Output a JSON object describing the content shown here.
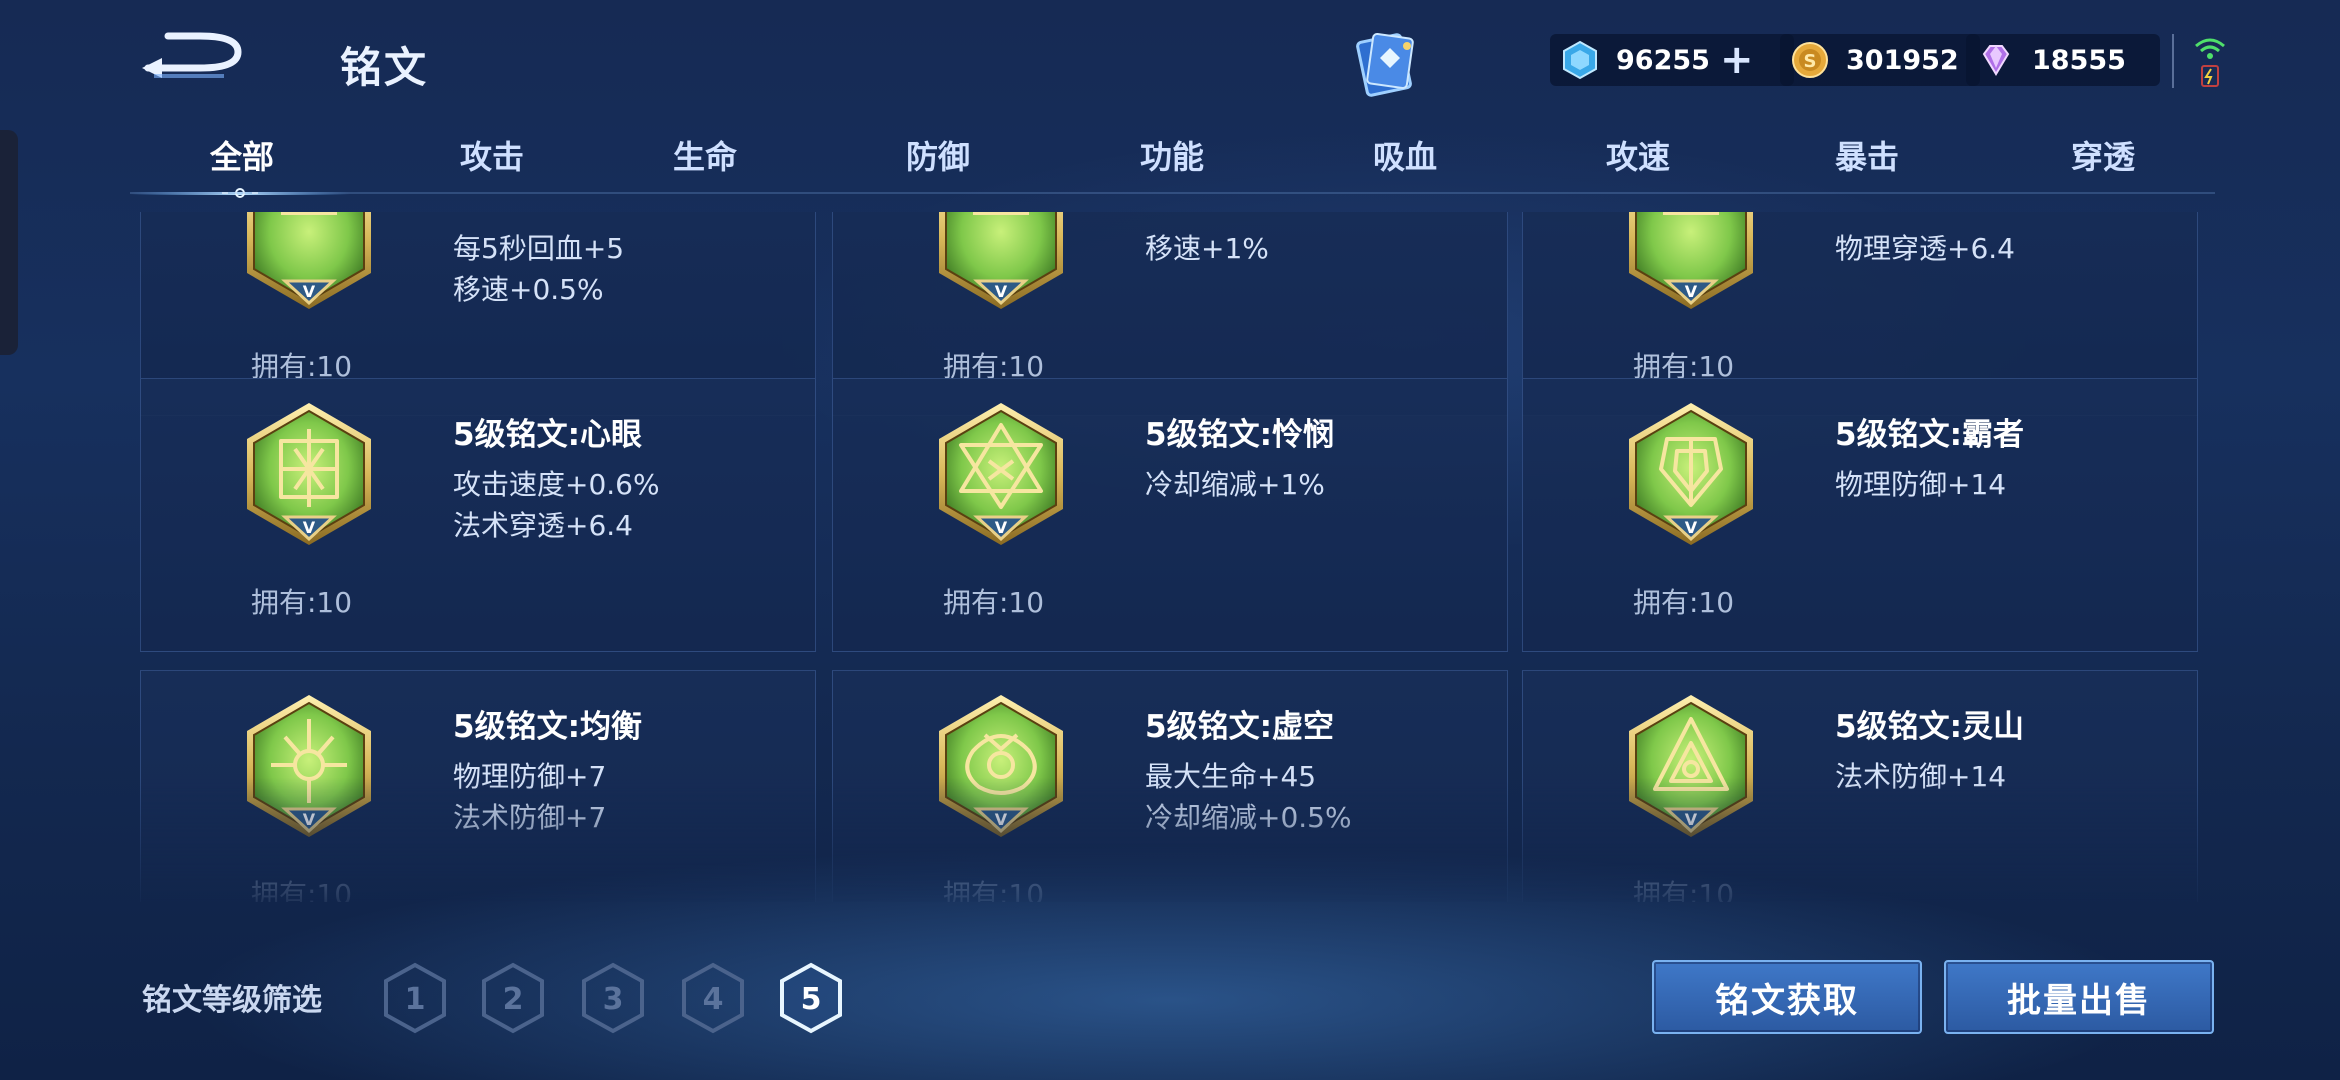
{
  "header": {
    "title": "铭文",
    "currency": {
      "diamond": "96255",
      "diamond_plus": "+",
      "gold": "301952",
      "gem": "18555"
    }
  },
  "tabs": [
    {
      "label": "全部",
      "active": true
    },
    {
      "label": "攻击"
    },
    {
      "label": "生命"
    },
    {
      "label": "防御"
    },
    {
      "label": "功能"
    },
    {
      "label": "吸血"
    },
    {
      "label": "攻速"
    },
    {
      "label": "暴击"
    },
    {
      "label": "穿透"
    }
  ],
  "inscriptions": [
    {
      "name": "",
      "attr1": "每5秒回血+5",
      "attr2": "移速+0.5%",
      "owned": "拥有:10",
      "icon": "inscription-partial-icon"
    },
    {
      "name": "",
      "attr1": "移速+1%",
      "attr2": "",
      "owned": "拥有:10",
      "icon": "inscription-partial-icon"
    },
    {
      "name": "",
      "attr1": "物理穿透+6.4",
      "attr2": "",
      "owned": "拥有:10",
      "icon": "inscription-partial-icon"
    },
    {
      "name": "5级铭文:心眼",
      "attr1": "攻击速度+0.6%",
      "attr2": "法术穿透+6.4",
      "owned": "拥有:10",
      "icon": "xinyan-icon"
    },
    {
      "name": "5级铭文:怜悯",
      "attr1": "冷却缩减+1%",
      "attr2": "",
      "owned": "拥有:10",
      "icon": "lianmin-icon"
    },
    {
      "name": "5级铭文:霸者",
      "attr1": "物理防御+14",
      "attr2": "",
      "owned": "拥有:10",
      "icon": "bazhe-icon"
    },
    {
      "name": "5级铭文:均衡",
      "attr1": "物理防御+7",
      "attr2": "法术防御+7",
      "owned": "拥有:10",
      "icon": "junheng-icon"
    },
    {
      "name": "5级铭文:虚空",
      "attr1": "最大生命+45",
      "attr2": "冷却缩减+0.5%",
      "owned": "拥有:10",
      "icon": "xukong-icon"
    },
    {
      "name": "5级铭文:灵山",
      "attr1": "法术防御+14",
      "attr2": "",
      "owned": "拥有:10",
      "icon": "lingshan-icon"
    }
  ],
  "filter": {
    "label": "铭文等级筛选",
    "levels": [
      "1",
      "2",
      "3",
      "4",
      "5"
    ],
    "selected": "5"
  },
  "buttons": {
    "get": "铭文获取",
    "sell": "批量出售"
  },
  "colors": {
    "accent": "#3f78c8",
    "inscription_green": "#7fc84a",
    "inscription_gold": "#d8b85a"
  }
}
